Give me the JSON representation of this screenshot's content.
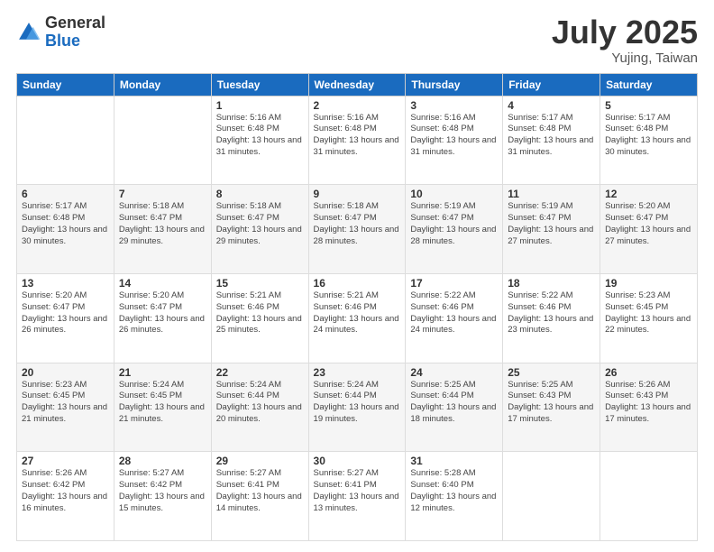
{
  "logo": {
    "general": "General",
    "blue": "Blue"
  },
  "header": {
    "month_year": "July 2025",
    "location": "Yujing, Taiwan"
  },
  "weekdays": [
    "Sunday",
    "Monday",
    "Tuesday",
    "Wednesday",
    "Thursday",
    "Friday",
    "Saturday"
  ],
  "weeks": [
    [
      {
        "day": "",
        "info": ""
      },
      {
        "day": "",
        "info": ""
      },
      {
        "day": "1",
        "info": "Sunrise: 5:16 AM\nSunset: 6:48 PM\nDaylight: 13 hours and 31 minutes."
      },
      {
        "day": "2",
        "info": "Sunrise: 5:16 AM\nSunset: 6:48 PM\nDaylight: 13 hours and 31 minutes."
      },
      {
        "day": "3",
        "info": "Sunrise: 5:16 AM\nSunset: 6:48 PM\nDaylight: 13 hours and 31 minutes."
      },
      {
        "day": "4",
        "info": "Sunrise: 5:17 AM\nSunset: 6:48 PM\nDaylight: 13 hours and 31 minutes."
      },
      {
        "day": "5",
        "info": "Sunrise: 5:17 AM\nSunset: 6:48 PM\nDaylight: 13 hours and 30 minutes."
      }
    ],
    [
      {
        "day": "6",
        "info": "Sunrise: 5:17 AM\nSunset: 6:48 PM\nDaylight: 13 hours and 30 minutes."
      },
      {
        "day": "7",
        "info": "Sunrise: 5:18 AM\nSunset: 6:47 PM\nDaylight: 13 hours and 29 minutes."
      },
      {
        "day": "8",
        "info": "Sunrise: 5:18 AM\nSunset: 6:47 PM\nDaylight: 13 hours and 29 minutes."
      },
      {
        "day": "9",
        "info": "Sunrise: 5:18 AM\nSunset: 6:47 PM\nDaylight: 13 hours and 28 minutes."
      },
      {
        "day": "10",
        "info": "Sunrise: 5:19 AM\nSunset: 6:47 PM\nDaylight: 13 hours and 28 minutes."
      },
      {
        "day": "11",
        "info": "Sunrise: 5:19 AM\nSunset: 6:47 PM\nDaylight: 13 hours and 27 minutes."
      },
      {
        "day": "12",
        "info": "Sunrise: 5:20 AM\nSunset: 6:47 PM\nDaylight: 13 hours and 27 minutes."
      }
    ],
    [
      {
        "day": "13",
        "info": "Sunrise: 5:20 AM\nSunset: 6:47 PM\nDaylight: 13 hours and 26 minutes."
      },
      {
        "day": "14",
        "info": "Sunrise: 5:20 AM\nSunset: 6:47 PM\nDaylight: 13 hours and 26 minutes."
      },
      {
        "day": "15",
        "info": "Sunrise: 5:21 AM\nSunset: 6:46 PM\nDaylight: 13 hours and 25 minutes."
      },
      {
        "day": "16",
        "info": "Sunrise: 5:21 AM\nSunset: 6:46 PM\nDaylight: 13 hours and 24 minutes."
      },
      {
        "day": "17",
        "info": "Sunrise: 5:22 AM\nSunset: 6:46 PM\nDaylight: 13 hours and 24 minutes."
      },
      {
        "day": "18",
        "info": "Sunrise: 5:22 AM\nSunset: 6:46 PM\nDaylight: 13 hours and 23 minutes."
      },
      {
        "day": "19",
        "info": "Sunrise: 5:23 AM\nSunset: 6:45 PM\nDaylight: 13 hours and 22 minutes."
      }
    ],
    [
      {
        "day": "20",
        "info": "Sunrise: 5:23 AM\nSunset: 6:45 PM\nDaylight: 13 hours and 21 minutes."
      },
      {
        "day": "21",
        "info": "Sunrise: 5:24 AM\nSunset: 6:45 PM\nDaylight: 13 hours and 21 minutes."
      },
      {
        "day": "22",
        "info": "Sunrise: 5:24 AM\nSunset: 6:44 PM\nDaylight: 13 hours and 20 minutes."
      },
      {
        "day": "23",
        "info": "Sunrise: 5:24 AM\nSunset: 6:44 PM\nDaylight: 13 hours and 19 minutes."
      },
      {
        "day": "24",
        "info": "Sunrise: 5:25 AM\nSunset: 6:44 PM\nDaylight: 13 hours and 18 minutes."
      },
      {
        "day": "25",
        "info": "Sunrise: 5:25 AM\nSunset: 6:43 PM\nDaylight: 13 hours and 17 minutes."
      },
      {
        "day": "26",
        "info": "Sunrise: 5:26 AM\nSunset: 6:43 PM\nDaylight: 13 hours and 17 minutes."
      }
    ],
    [
      {
        "day": "27",
        "info": "Sunrise: 5:26 AM\nSunset: 6:42 PM\nDaylight: 13 hours and 16 minutes."
      },
      {
        "day": "28",
        "info": "Sunrise: 5:27 AM\nSunset: 6:42 PM\nDaylight: 13 hours and 15 minutes."
      },
      {
        "day": "29",
        "info": "Sunrise: 5:27 AM\nSunset: 6:41 PM\nDaylight: 13 hours and 14 minutes."
      },
      {
        "day": "30",
        "info": "Sunrise: 5:27 AM\nSunset: 6:41 PM\nDaylight: 13 hours and 13 minutes."
      },
      {
        "day": "31",
        "info": "Sunrise: 5:28 AM\nSunset: 6:40 PM\nDaylight: 13 hours and 12 minutes."
      },
      {
        "day": "",
        "info": ""
      },
      {
        "day": "",
        "info": ""
      }
    ]
  ]
}
